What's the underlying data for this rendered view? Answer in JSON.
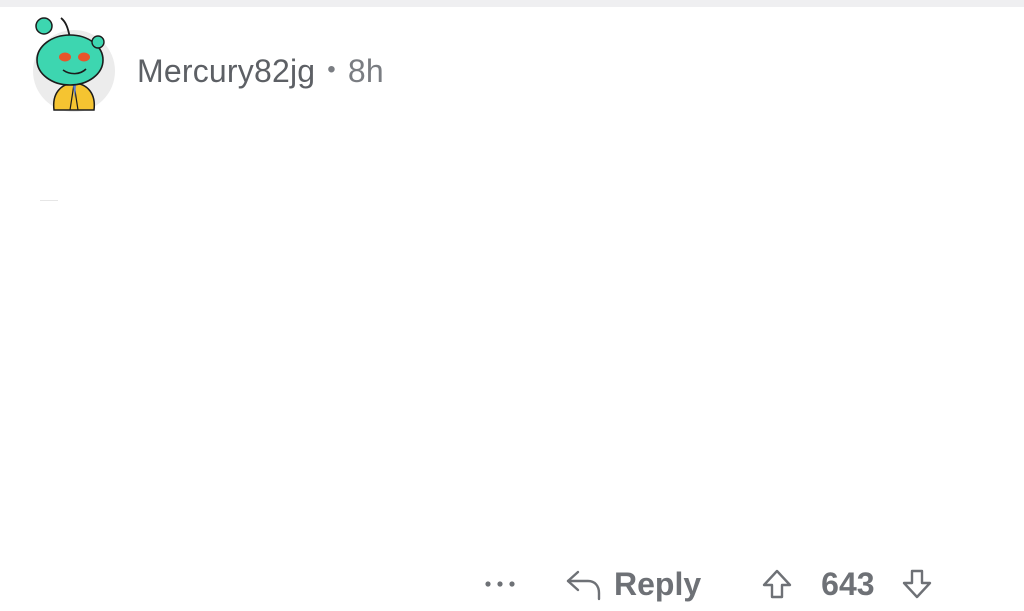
{
  "comment": {
    "author": "Mercury82jg",
    "separator": "•",
    "age": "8h",
    "avatar_icon": "snoo-avatar-yellow-jacket-icon"
  },
  "actions": {
    "more_icon": "ellipsis-icon",
    "reply_icon": "reply-arrow-icon",
    "reply_label": "Reply",
    "upvote_icon": "upvote-arrow-icon",
    "score": "643",
    "downvote_icon": "downvote-arrow-icon"
  },
  "colors": {
    "text_primary": "#5d6065",
    "text_secondary": "#7a7d82",
    "avatar_head": "#3dd6b0",
    "avatar_jacket": "#f5c431"
  }
}
